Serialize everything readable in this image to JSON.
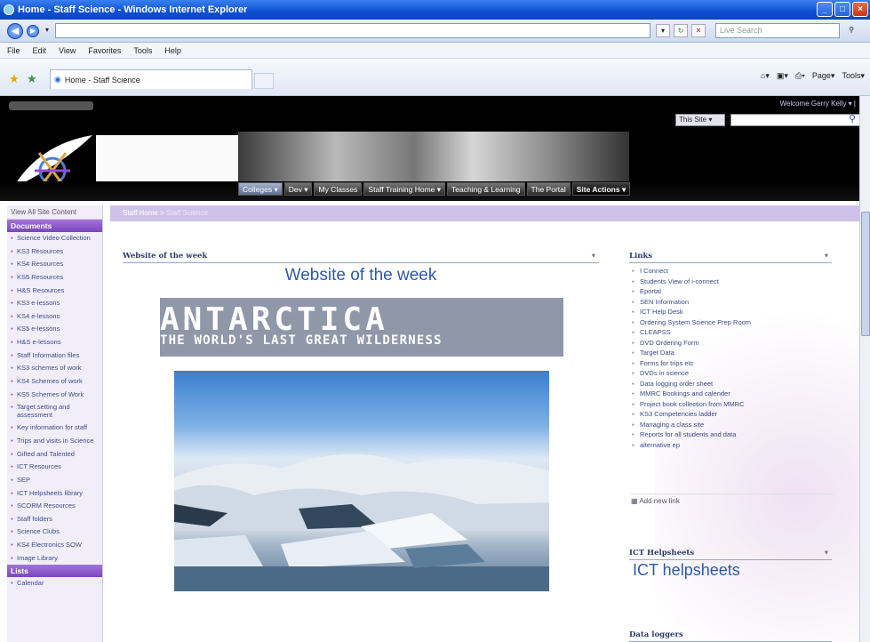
{
  "window": {
    "title": "Home - Staff Science - Windows Internet Explorer",
    "controls": [
      "_",
      "□",
      "×"
    ]
  },
  "address": {
    "search_placeholder": "Live Search"
  },
  "menu": [
    "File",
    "Edit",
    "View",
    "Favorites",
    "Tools",
    "Help"
  ],
  "tab": {
    "label": "Home - Staff Science"
  },
  "commandbar": {
    "page": "Page",
    "tools": "Tools"
  },
  "header": {
    "welcome": "Welcome Gerry Kelly",
    "scope": "This Site",
    "topnav": [
      "Colleges",
      "Dev",
      "My Classes",
      "Staff Training Home",
      "Teaching & Learning",
      "The Portal",
      "Site Actions"
    ]
  },
  "leftnav": {
    "view_all": "View All Site Content",
    "documents_header": "Documents",
    "documents": [
      "Science Video Collection",
      "KS3 Resources",
      "KS4 Resources",
      "KS5 Resources",
      "H&S Resources",
      "KS3 e-lessons",
      "KS4 e-lessons",
      "KS5 e-lessons",
      "H&S e-lessons",
      "Staff Information files",
      "KS3 schemes of work",
      "KS4 Schemes of work",
      "KS5 Schemes of Work",
      "Target setting and assessment",
      "Key information for staff",
      "Trips and visits in Science",
      "Gifted and Talented",
      "ICT Resources",
      "SEP",
      "ICT Helpsheets library",
      "SCORM Resources",
      "Staff folders",
      "Science Clubs",
      "KS4 Electronics SOW",
      "Image Library"
    ],
    "lists_header": "Lists",
    "lists": [
      "Calendar"
    ]
  },
  "breadcrumb": {
    "home": "Staff Home",
    "sep": ">",
    "current": "Staff Science"
  },
  "website_of_week": {
    "web_part_title": "Website of the week",
    "heading": "Website of the week",
    "banner_title": "ANTARCTICA",
    "banner_subtitle": "THE WORLD'S LAST GREAT WILDERNESS"
  },
  "links": {
    "title": "Links",
    "items": [
      "I Connect",
      "Students View of i-connect",
      "Eportal",
      "SEN Information",
      "ICT Help Desk",
      "Ordering System Science Prep Room",
      "CLEAPSS",
      "DVD Ordering Form",
      "Target Data",
      "Forms for trips etc",
      "DVDs in science",
      "Data logging order sheet",
      "MMRC Bookings and calender",
      "Project book collection from MMRC",
      "KS3 Competencies ladder",
      "Managing a class site",
      "Reports for all students and data",
      "alternative ep"
    ],
    "add_new": "Add new link"
  },
  "ict_helpsheets": {
    "title": "ICT Helpsheets",
    "heading": "ICT helpsheets"
  },
  "data_loggers": {
    "title": "Data loggers"
  }
}
